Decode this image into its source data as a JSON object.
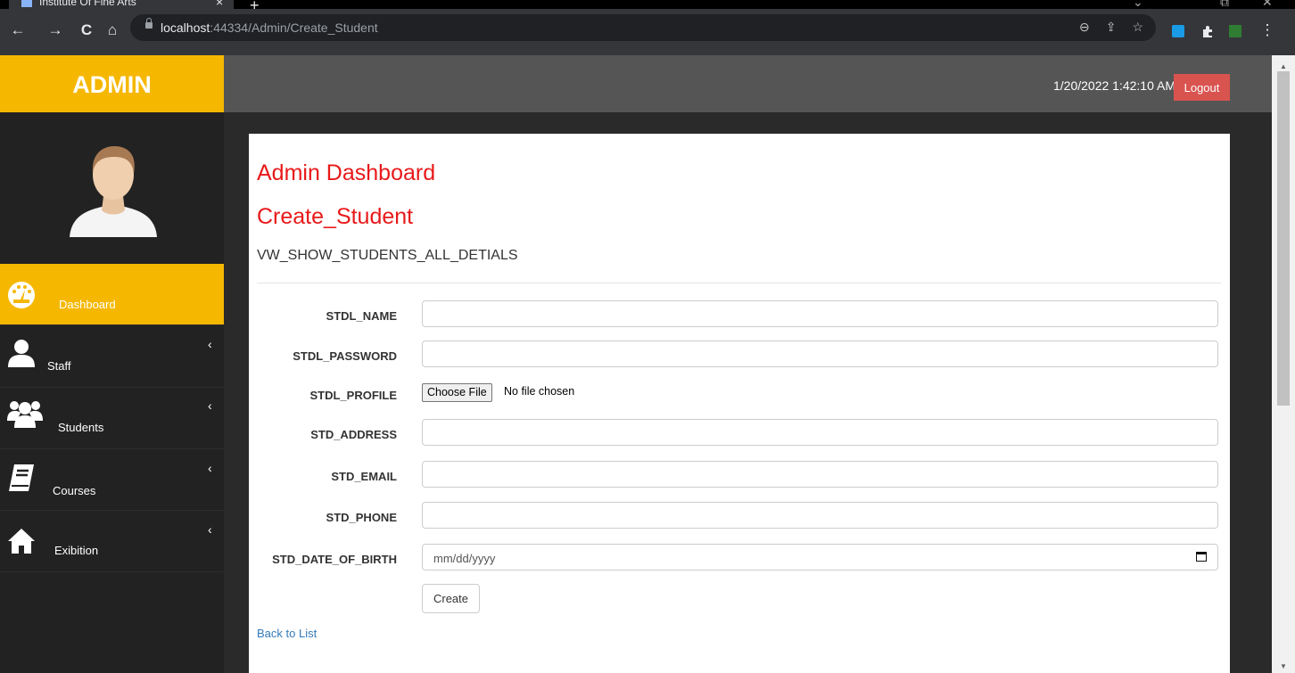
{
  "browser": {
    "tab_title": "Institute Of Fine Arts",
    "tab_close": "×",
    "new_tab": "+",
    "url_host": "localhost",
    "url_path": ":44334/Admin/Create_Student",
    "back": "←",
    "forward": "→",
    "reload": "C",
    "home": "⌂",
    "zoom_icon": "⊖",
    "share_icon": "⇪",
    "star_icon": "☆",
    "menu": "⋮"
  },
  "header": {
    "brand": "ADMIN",
    "datetime": "1/20/2022 1:42:10 AM",
    "logout": "Logout"
  },
  "sidebar": {
    "items": [
      {
        "label": "Dashboard",
        "icon": "dashboard-icon",
        "active": true
      },
      {
        "label": "Staff",
        "icon": "user-icon"
      },
      {
        "label": "Students",
        "icon": "users-icon"
      },
      {
        "label": "Courses",
        "icon": "book-icon"
      },
      {
        "label": "Exibition",
        "icon": "home-icon"
      }
    ],
    "chevron": "‹"
  },
  "page": {
    "title": "Admin Dashboard",
    "subtitle": "Create_Student",
    "section": "VW_SHOW_STUDENTS_ALL_DETIALS"
  },
  "form": {
    "name_label": "STDL_NAME",
    "password_label": "STDL_PASSWORD",
    "profile_label": "STDL_PROFILE",
    "choose_file": "Choose File",
    "no_file": "No file chosen",
    "address_label": "STD_ADDRESS",
    "email_label": "STD_EMAIL",
    "phone_label": "STD_PHONE",
    "dob_label": "STD_DATE_OF_BIRTH",
    "dob_placeholder": "mm/dd/yyyy",
    "create": "Create",
    "back_to_list": "Back to List"
  },
  "colors": {
    "accent": "#f5b700",
    "heading": "#e8191a",
    "logout": "#d9534f"
  }
}
